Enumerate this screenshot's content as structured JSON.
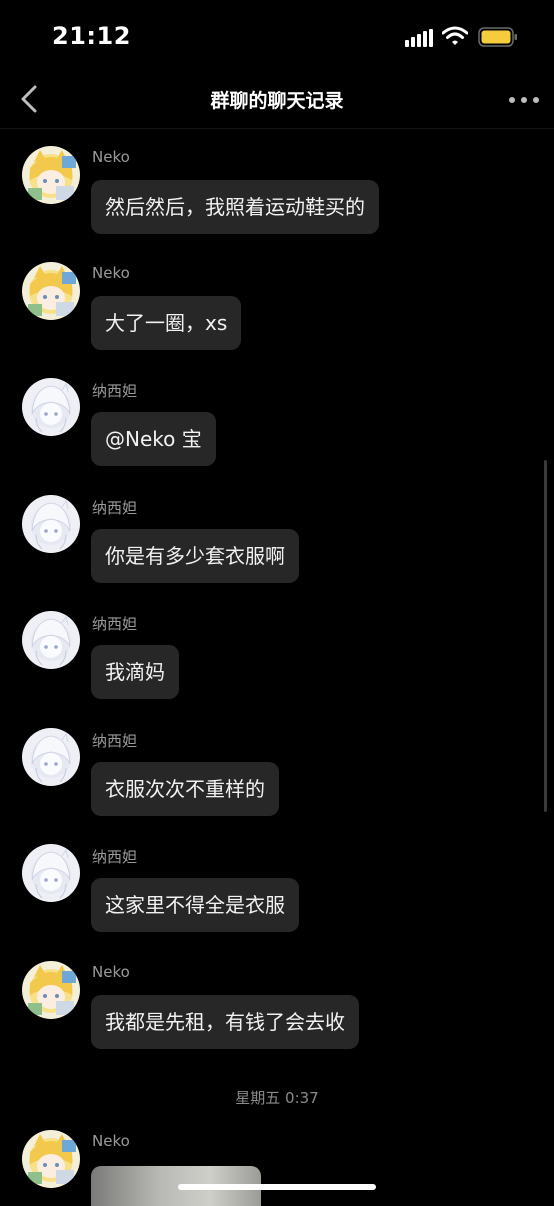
{
  "status_bar": {
    "time": "21:12"
  },
  "header": {
    "title": "群聊的聊天记录"
  },
  "messages": [
    {
      "sender": "Neko",
      "text": "然后然后，我照着运动鞋买的",
      "avatar": "neko-avatar"
    },
    {
      "sender": "Neko",
      "text": "大了一圈，xs",
      "avatar": "neko-avatar"
    },
    {
      "sender": "纳西妲",
      "text": "@Neko 宝",
      "avatar": "nahida-avatar"
    },
    {
      "sender": "纳西妲",
      "text": "你是有多少套衣服啊",
      "avatar": "nahida-avatar"
    },
    {
      "sender": "纳西妲",
      "text": "我滴妈",
      "avatar": "nahida-avatar"
    },
    {
      "sender": "纳西妲",
      "text": "衣服次次不重样的",
      "avatar": "nahida-avatar"
    },
    {
      "sender": "纳西妲",
      "text": "这家里不得全是衣服",
      "avatar": "nahida-avatar"
    },
    {
      "sender": "Neko",
      "text": "我都是先租，有钱了会去收",
      "avatar": "neko-avatar"
    }
  ],
  "timestamp": "星期五 0:37",
  "last_message": {
    "sender": "Neko",
    "type": "image",
    "avatar": "neko-avatar"
  },
  "colors": {
    "background": "#000000",
    "bubble": "#272727",
    "battery": "#f5cc3b"
  }
}
